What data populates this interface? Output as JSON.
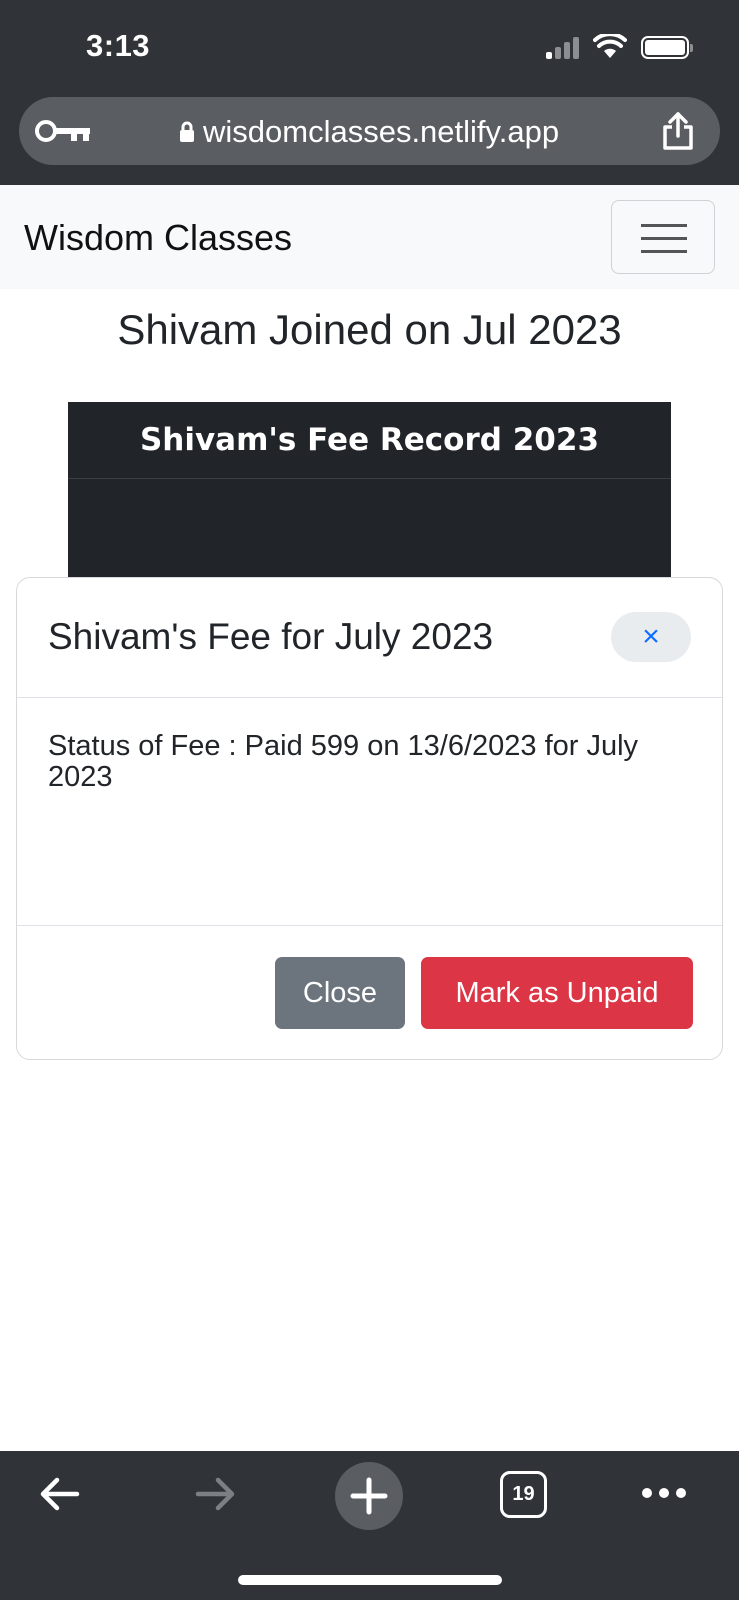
{
  "status_bar": {
    "time": "3:13"
  },
  "browser": {
    "url": "wisdomclasses.netlify.app",
    "tab_count": "19"
  },
  "navbar": {
    "brand": "Wisdom Classes"
  },
  "page": {
    "heading": "Shivam Joined on Jul 2023",
    "table_title": "Shivam's Fee Record 2023"
  },
  "modal": {
    "title": "Shivam's Fee for July 2023",
    "close_symbol": "×",
    "body": "Status of Fee : Paid 599 on 13/6/2023 for July 2023",
    "close_label": "Close",
    "unpaid_label": "Mark as Unpaid"
  },
  "colors": {
    "browser_chrome": "#303337",
    "close_button": "#6c757d",
    "unpaid_button": "#dc3545",
    "table_background": "#212529"
  }
}
